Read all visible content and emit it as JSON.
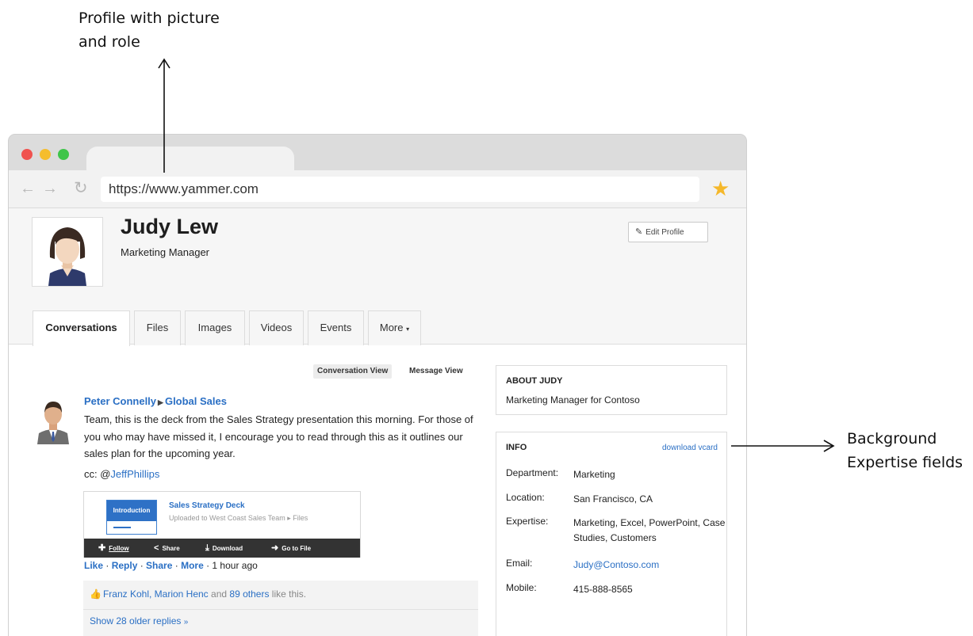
{
  "callouts": {
    "top_line1": "Profile with picture",
    "top_line2": "and role",
    "right_line1": "Background",
    "right_line2": "Expertise fields"
  },
  "browser": {
    "url": "https://www.yammer.com",
    "icons": {
      "back": "arrow-left-icon",
      "forward": "arrow-right-icon",
      "reload": "reload-icon",
      "bookmark": "star-icon"
    },
    "colors": {
      "close": "#f0524f",
      "minimize": "#f5bd2d",
      "maximize": "#3fc54a",
      "star": "#f5b82b"
    }
  },
  "profile": {
    "name": "Judy Lew",
    "role": "Marketing Manager",
    "edit_label": "Edit Profile"
  },
  "tabs": [
    "Conversations",
    "Files",
    "Images",
    "Videos",
    "Events",
    "More"
  ],
  "feed": {
    "view_conversation": "Conversation View",
    "view_message": "Message View",
    "poster_name": "Peter Connelly",
    "poster_group": "Global Sales",
    "body": "Team, this is the deck from the Sales Strategy presentation this morning. For those of you who may have missed it, I encourage you to read through this as it outlines our sales plan for the upcoming year.",
    "cc_prefix": "cc: @",
    "cc_name": "JeffPhillips",
    "attachment": {
      "thumb_label": "Introduction",
      "title": "Sales Strategy Deck",
      "subtitle": "Uploaded to West Coast Sales Team ▸ Files",
      "actions": [
        "Follow",
        "Share",
        "Download",
        "Go to File"
      ]
    },
    "actions": {
      "like": "Like",
      "reply": "Reply",
      "share": "Share",
      "more": "More",
      "time": "1 hour ago"
    },
    "likes": {
      "names": "Franz Kohl, Marion Henc",
      "and": "and",
      "others": "89 others",
      "suffix": "like this."
    },
    "older_replies": "Show 28 older replies"
  },
  "sidebar": {
    "about_title": "ABOUT JUDY",
    "about_text": "Marketing Manager for Contoso",
    "info_title": "INFO",
    "vcard": "download vcard",
    "rows": [
      {
        "label": "Department:",
        "value": "Marketing"
      },
      {
        "label": "Location:",
        "value": "San Francisco, CA"
      },
      {
        "label": "Expertise:",
        "value": "Marketing, Excel, PowerPoint, Case Studies, Customers"
      },
      {
        "label": "Email:",
        "value": "Judy@Contoso.com"
      },
      {
        "label": "Mobile:",
        "value": "415-888-8565"
      }
    ]
  }
}
